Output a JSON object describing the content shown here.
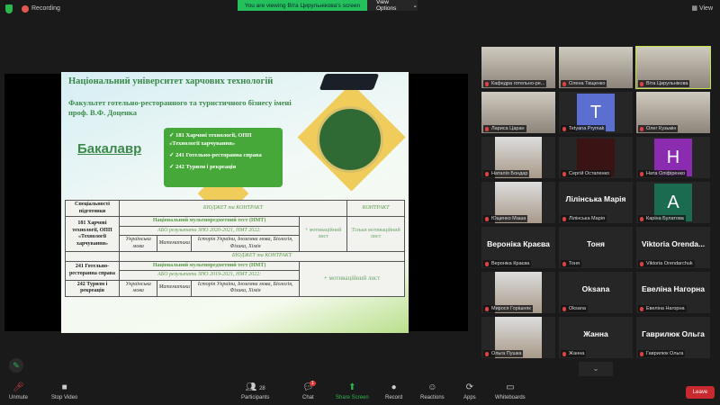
{
  "topbar": {
    "recording": "Recording",
    "viewing": "You are viewing Віта Цирульнікова's screen",
    "view_options": "View Options",
    "view": "View"
  },
  "slide": {
    "title": "Національний університет харчових технологій",
    "faculty": "Факультет готельно-ресторанного та туристичного бізнесу імені проф. В.Ф. Доценка",
    "degree": "Бакалавр",
    "programs": [
      "✓ 181 Харчові технології, ОПП «Технології харчування»",
      "✓ 241 Готельно-ресторанна справа",
      "✓ 242 Туризм і рекреація"
    ],
    "table": {
      "h_spec": "Спеціальності підготовки",
      "h_budget": "БЮДЖЕТ та КОНТРАКТ",
      "h_contract": "КОНТРАКТ",
      "spec181": "181 Харчові технології, ОПП «Технології харчування»",
      "nmt": "Національний мультипредметний тест (НМТ)",
      "or_zno1": "АБО результати ЗНО 2020-2021, НМТ 2022:",
      "ukr": "Українська мова",
      "math": "Математика",
      "hist1": "Історія України, Іноземна мова, Біологія, Фізика, Хімія",
      "motiv": "+ мотиваційний лист",
      "only_motiv": "Тільки мотиваційний лист",
      "budget2": "БЮДЖЕТ та КОНТРАКТ",
      "spec241": "241 Готельно-ресторанна справа",
      "spec242": "242 Туризм і рекреація",
      "or_zno2": "АБО результати ЗНО 2019-2021, НМТ 2022:",
      "hist2": "Історія України, Іноземна мова, Біологія, Фізика, Хімія"
    }
  },
  "participants": [
    {
      "name": "Кафедра готельно-ре...",
      "type": "video"
    },
    {
      "name": "Олена Тищенко",
      "type": "video"
    },
    {
      "name": "Віта Цирульнікова",
      "type": "video",
      "active": true
    },
    {
      "name": "Лариса Царан",
      "type": "video"
    },
    {
      "name": "Tetyana Prymak",
      "type": "avatar",
      "letter": "T",
      "color": "#5b6fd1"
    },
    {
      "name": "Олег Кузьмін",
      "type": "video"
    },
    {
      "name": "Наталія Бондар",
      "type": "photo"
    },
    {
      "name": "Сергій Остапенко",
      "type": "avatar",
      "letter": "",
      "color": "#3a1414"
    },
    {
      "name": "Ната Оліфіренко",
      "type": "avatar",
      "letter": "H",
      "color": "#8a2bb0"
    },
    {
      "name": "Ющенко Маша",
      "type": "photo"
    },
    {
      "name": "Лілінська Марія",
      "type": "text",
      "big": "Лілінська Марія"
    },
    {
      "name": "Каріна Булатова",
      "type": "avatar",
      "letter": "A",
      "color": "#1a6b50"
    },
    {
      "name": "Вероніка Краєва",
      "type": "text",
      "big": "Вероніка Краєва"
    },
    {
      "name": "Тоня",
      "type": "text",
      "big": "Тоня"
    },
    {
      "name": "Viktoria Orendarchuk",
      "type": "text",
      "big": "Viktoria  Orenda..."
    },
    {
      "name": "Мирося Горішняк",
      "type": "photo"
    },
    {
      "name": "Oksana",
      "type": "text",
      "big": "Oksana"
    },
    {
      "name": "Евеліна Нагорна",
      "type": "text",
      "big": "Евеліна Нагорна"
    },
    {
      "name": "Ольга Пушка",
      "type": "photo"
    },
    {
      "name": "Жанна",
      "type": "text",
      "big": "Жанна"
    },
    {
      "name": "Гаврилюк Ольга",
      "type": "text",
      "big": "Гаврилюк Ольга"
    }
  ],
  "toolbar": {
    "unmute": "Unmute",
    "stop_video": "Stop Video",
    "participants": "Participants",
    "participants_count": "28",
    "chat": "Chat",
    "chat_badge": "1",
    "share": "Share Screen",
    "record": "Record",
    "reactions": "Reactions",
    "apps": "Apps",
    "whiteboards": "Whiteboards",
    "leave": "Leave"
  }
}
